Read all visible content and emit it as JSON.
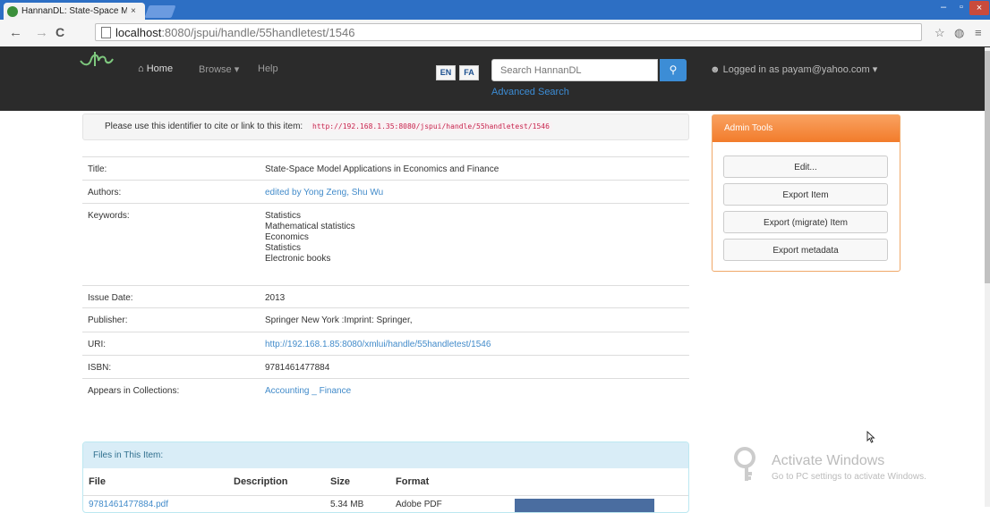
{
  "browser": {
    "tab_title": "HannanDL: State-Space M",
    "tab_close": "×",
    "url_host": "localhost",
    "url_path": ":8080/jspui/handle/55handletest/1546",
    "back": "←",
    "forward": "→",
    "reload": "C"
  },
  "navbar": {
    "home": "Home",
    "browse": "Browse ▾",
    "help": "Help",
    "lang_en": "EN",
    "lang_fa": "FA",
    "search_placeholder": "Search HannanDL",
    "advanced_search": "Advanced Search",
    "logged_in": "Logged in as payam@yahoo.com ▾"
  },
  "identifier": {
    "text": "Please use this identifier to cite or link to this item:",
    "handle": "http://192.168.1.35:8080/jspui/handle/55handletest/1546"
  },
  "metadata": {
    "title_label": "Title:",
    "title_value": "State-Space Model Applications in Economics and Finance",
    "authors_label": "Authors:",
    "authors_value": "edited by Yong Zeng, Shu Wu",
    "keywords_label": "Keywords:",
    "keywords": [
      "Statistics",
      "Mathematical statistics",
      "Economics",
      "Statistics",
      "Electronic books"
    ],
    "issue_label": "Issue Date:",
    "issue_value": "2013",
    "publisher_label": "Publisher:",
    "publisher_value": "Springer New York :Imprint: Springer,",
    "uri_label": "URI:",
    "uri_value": "http://192.168.1.85:8080/xmlui/handle/55handletest/1546",
    "isbn_label": "ISBN:",
    "isbn_value": "9781461477884",
    "collections_label": "Appears in Collections:",
    "collections_value": "Accounting _ Finance"
  },
  "files": {
    "heading": "Files in This Item:",
    "col_file": "File",
    "col_description": "Description",
    "col_size": "Size",
    "col_format": "Format",
    "row_file": "9781461477884.pdf",
    "row_size": "5.34 MB",
    "row_format": "Adobe PDF"
  },
  "admin": {
    "heading": "Admin Tools",
    "edit": "Edit...",
    "export_item": "Export Item",
    "export_migrate": "Export (migrate) Item",
    "export_metadata": "Export metadata"
  },
  "watermark": {
    "title": "Activate Windows",
    "subtitle": "Go to PC settings to activate Windows."
  }
}
